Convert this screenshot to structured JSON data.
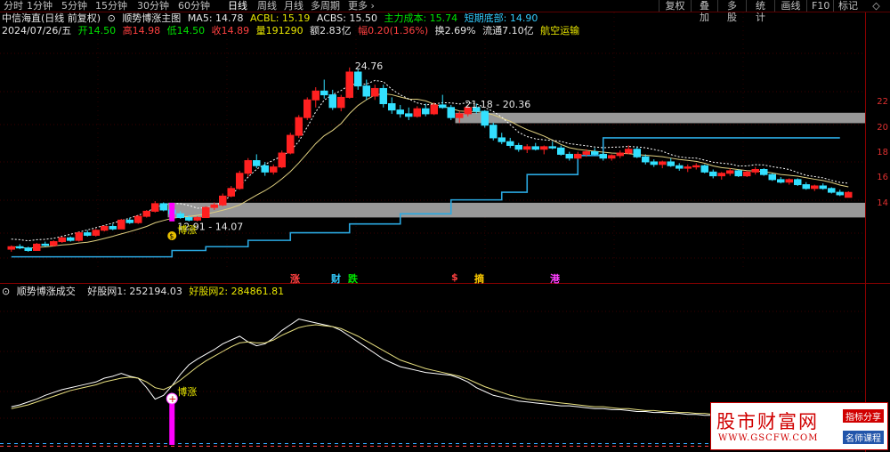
{
  "toolbar": {
    "periods": [
      "分时",
      "1分钟",
      "5分钟",
      "15分钟",
      "30分钟",
      "60分钟",
      "日线",
      "周线",
      "月线",
      "多周期",
      "更多"
    ],
    "active_period": "日线",
    "right_buttons": [
      "复权",
      "叠加",
      "多股",
      "统计",
      "画线",
      "F10",
      "标记"
    ]
  },
  "header": {
    "stock_name": "中信海直(日线 前复权)",
    "indicator_name": "顺势博涨主图",
    "ma5": "MA5: 14.78",
    "acbl": "ACBL: 15.19",
    "acbs": "ACBS: 15.50",
    "main_cost": "主力成本: 15.74",
    "short_bottom": "短期底部: 14.90"
  },
  "quote": {
    "date": "2024/07/26/五",
    "open": "开14.50",
    "high": "高14.98",
    "low": "低14.50",
    "close": "收14.89",
    "volume": "量191290",
    "amount": "额2.83亿",
    "change": "幅0.20(1.36%)",
    "turnover": "换2.69%",
    "float": "流通7.10亿",
    "sector": "航空运输"
  },
  "price_axis": [
    "22",
    "20",
    "18",
    "16",
    "14"
  ],
  "annotations": {
    "peak": "24.76",
    "zone_upper": "21.18 - 20.36",
    "zone_lower": "12.91 - 14.07",
    "buy_label": "博涨",
    "coin_icon_text": "$"
  },
  "events": [
    {
      "label": "涨",
      "color": "#ff4040"
    },
    {
      "label": "财",
      "color": "#33ccff"
    },
    {
      "label": "跌",
      "color": "#00e600"
    },
    {
      "label": "$",
      "color": "#ff4040"
    },
    {
      "label": "摘",
      "color": "#ffcc00"
    },
    {
      "label": "港",
      "color": "#ff40ff"
    }
  ],
  "sub": {
    "title": "顺势博涨成交",
    "v1": "好股网1: 252194.03",
    "v2": "好股网2: 284861.81",
    "buy_label": "博涨"
  },
  "watermark": {
    "main": "股市财富网",
    "url": "WWW.GSCFW.COM",
    "tag1": "指标分享",
    "tag2": "名师课程"
  },
  "colors": {
    "up": "#ff2020",
    "down": "#33e0ff",
    "ma": "#e0d080",
    "support": "#2aa8e0",
    "zone": "#a8a8a8",
    "signal": "#ff00ff"
  },
  "chart_data": {
    "type": "candlestick",
    "candles": [
      [
        10.4,
        10.7,
        10.2,
        10.6
      ],
      [
        10.6,
        10.8,
        10.4,
        10.5
      ],
      [
        10.5,
        10.6,
        10.2,
        10.3
      ],
      [
        10.3,
        10.9,
        10.3,
        10.8
      ],
      [
        10.8,
        11.0,
        10.6,
        10.7
      ],
      [
        10.7,
        11.1,
        10.6,
        11.0
      ],
      [
        11.0,
        11.4,
        10.9,
        11.3
      ],
      [
        11.3,
        11.4,
        11.0,
        11.1
      ],
      [
        11.1,
        11.8,
        11.0,
        11.7
      ],
      [
        11.7,
        11.9,
        11.4,
        11.5
      ],
      [
        11.5,
        12.0,
        11.4,
        11.9
      ],
      [
        11.9,
        12.3,
        11.8,
        12.2
      ],
      [
        12.2,
        12.4,
        11.9,
        12.0
      ],
      [
        12.0,
        12.8,
        12.0,
        12.7
      ],
      [
        12.7,
        12.9,
        12.4,
        12.5
      ],
      [
        12.5,
        13.1,
        12.4,
        13.0
      ],
      [
        13.0,
        13.5,
        12.9,
        13.4
      ],
      [
        13.4,
        14.2,
        13.3,
        14.0
      ],
      [
        14.0,
        14.1,
        13.4,
        13.5
      ],
      [
        13.5,
        13.8,
        13.1,
        13.2
      ],
      [
        13.2,
        13.4,
        12.8,
        12.9
      ],
      [
        12.9,
        13.1,
        12.6,
        12.7
      ],
      [
        12.7,
        13.0,
        12.6,
        12.9
      ],
      [
        12.9,
        13.8,
        12.9,
        13.7
      ],
      [
        13.7,
        14.1,
        13.5,
        13.9
      ],
      [
        13.9,
        14.8,
        13.8,
        14.6
      ],
      [
        14.6,
        15.4,
        14.5,
        15.2
      ],
      [
        15.2,
        16.6,
        15.1,
        16.4
      ],
      [
        16.4,
        17.6,
        16.1,
        17.4
      ],
      [
        17.4,
        17.9,
        16.8,
        17.0
      ],
      [
        17.0,
        17.3,
        16.2,
        16.5
      ],
      [
        16.5,
        17.1,
        16.3,
        16.9
      ],
      [
        16.9,
        18.2,
        16.8,
        18.0
      ],
      [
        18.0,
        19.6,
        17.9,
        19.4
      ],
      [
        19.4,
        21.0,
        19.2,
        20.8
      ],
      [
        20.8,
        22.4,
        20.6,
        22.2
      ],
      [
        22.2,
        23.2,
        21.6,
        22.9
      ],
      [
        22.9,
        23.8,
        22.3,
        22.6
      ],
      [
        22.6,
        23.0,
        21.4,
        21.6
      ],
      [
        21.6,
        22.6,
        21.3,
        22.4
      ],
      [
        22.4,
        24.76,
        22.3,
        24.4
      ],
      [
        24.4,
        24.6,
        23.0,
        23.3
      ],
      [
        23.3,
        23.8,
        22.2,
        22.5
      ],
      [
        22.5,
        23.4,
        22.2,
        23.1
      ],
      [
        23.1,
        23.4,
        21.6,
        21.9
      ],
      [
        21.9,
        22.4,
        21.1,
        21.4
      ],
      [
        21.4,
        21.8,
        20.8,
        21.1
      ],
      [
        21.1,
        21.6,
        20.6,
        20.9
      ],
      [
        20.9,
        21.7,
        20.8,
        21.5
      ],
      [
        21.5,
        21.9,
        20.9,
        21.1
      ],
      [
        21.1,
        22.0,
        21.0,
        21.8
      ],
      [
        21.8,
        22.6,
        21.5,
        21.6
      ],
      [
        21.6,
        21.8,
        20.6,
        20.8
      ],
      [
        20.8,
        21.3,
        20.4,
        21.1
      ],
      [
        21.1,
        21.8,
        20.9,
        21.6
      ],
      [
        21.6,
        21.9,
        21.1,
        21.3
      ],
      [
        21.3,
        21.4,
        20.0,
        20.2
      ],
      [
        20.2,
        20.4,
        19.0,
        19.2
      ],
      [
        19.2,
        19.6,
        18.7,
        18.9
      ],
      [
        18.9,
        19.2,
        18.4,
        18.6
      ],
      [
        18.6,
        18.8,
        18.1,
        18.3
      ],
      [
        18.3,
        18.7,
        18.0,
        18.5
      ],
      [
        18.5,
        18.8,
        18.2,
        18.3
      ],
      [
        18.3,
        18.6,
        17.9,
        18.5
      ],
      [
        18.5,
        18.9,
        18.3,
        18.4
      ],
      [
        18.4,
        18.6,
        17.8,
        17.9
      ],
      [
        17.9,
        18.1,
        17.4,
        17.6
      ],
      [
        17.6,
        18.1,
        17.5,
        17.9
      ],
      [
        17.9,
        18.3,
        17.7,
        18.1
      ],
      [
        18.1,
        18.4,
        17.8,
        17.9
      ],
      [
        17.9,
        18.1,
        17.4,
        17.6
      ],
      [
        17.6,
        17.9,
        17.4,
        17.8
      ],
      [
        17.8,
        18.2,
        17.6,
        18.0
      ],
      [
        18.0,
        18.6,
        17.9,
        18.3
      ],
      [
        18.3,
        18.5,
        17.6,
        17.7
      ],
      [
        17.7,
        17.9,
        17.1,
        17.3
      ],
      [
        17.3,
        17.5,
        16.9,
        17.1
      ],
      [
        17.1,
        17.4,
        16.8,
        17.3
      ],
      [
        17.3,
        17.6,
        16.9,
        17.0
      ],
      [
        17.0,
        17.2,
        16.6,
        16.8
      ],
      [
        16.8,
        17.1,
        16.5,
        16.9
      ],
      [
        16.9,
        17.2,
        16.7,
        17.0
      ],
      [
        17.0,
        17.1,
        16.4,
        16.5
      ],
      [
        16.5,
        16.7,
        16.0,
        16.2
      ],
      [
        16.2,
        16.5,
        15.9,
        16.4
      ],
      [
        16.4,
        16.8,
        16.2,
        16.6
      ],
      [
        16.6,
        16.7,
        16.1,
        16.2
      ],
      [
        16.2,
        16.6,
        16.1,
        16.5
      ],
      [
        16.5,
        16.9,
        16.3,
        16.7
      ],
      [
        16.7,
        16.8,
        16.2,
        16.3
      ],
      [
        16.3,
        16.4,
        15.8,
        15.9
      ],
      [
        15.9,
        16.1,
        15.6,
        15.7
      ],
      [
        15.7,
        16.0,
        15.5,
        15.9
      ],
      [
        15.9,
        16.0,
        15.4,
        15.5
      ],
      [
        15.5,
        15.7,
        15.1,
        15.2
      ],
      [
        15.2,
        15.5,
        15.0,
        15.4
      ],
      [
        15.4,
        15.6,
        15.1,
        15.2
      ],
      [
        15.2,
        15.3,
        14.8,
        14.9
      ],
      [
        14.9,
        15.1,
        14.6,
        14.7
      ],
      [
        14.5,
        14.98,
        14.5,
        14.89
      ]
    ],
    "y_range": [
      9.0,
      27.0
    ],
    "price_ticks": [
      22,
      20,
      18,
      16,
      14
    ],
    "zones": [
      {
        "label": "21.18 - 20.36",
        "low": 20.36,
        "high": 21.18,
        "from_index": 53
      },
      {
        "label": "12.91 - 14.07",
        "low": 12.91,
        "high": 14.07,
        "from_index": 19
      }
    ],
    "support_steps": [
      [
        0,
        9.8
      ],
      [
        19,
        10.3
      ],
      [
        23,
        10.6
      ],
      [
        28,
        11.1
      ],
      [
        33,
        11.7
      ],
      [
        40,
        12.4
      ],
      [
        46,
        13.2
      ],
      [
        52,
        14.3
      ],
      [
        58,
        14.9
      ],
      [
        61,
        16.3
      ],
      [
        67,
        17.8
      ],
      [
        70,
        19.2
      ],
      [
        98,
        19.2
      ]
    ],
    "sub_series1": [
      40,
      42,
      45,
      48,
      52,
      55,
      58,
      60,
      62,
      64,
      66,
      70,
      72,
      75,
      72,
      70,
      60,
      48,
      52,
      62,
      74,
      84,
      90,
      95,
      100,
      106,
      110,
      114,
      108,
      104,
      106,
      112,
      120,
      126,
      132,
      130,
      128,
      126,
      124,
      120,
      114,
      108,
      102,
      96,
      90,
      86,
      82,
      80,
      78,
      76,
      75,
      74,
      73,
      70,
      66,
      60,
      56,
      52,
      50,
      48,
      46,
      45,
      44,
      43,
      42,
      41,
      41,
      40,
      39,
      38,
      38,
      37,
      37,
      36,
      35,
      35,
      34,
      34,
      33,
      33,
      32,
      32,
      31,
      31,
      30,
      30,
      29,
      29,
      28,
      28,
      27,
      27,
      27,
      26,
      26,
      26,
      25,
      25,
      25,
      25
    ],
    "sub_series2": [
      38,
      40,
      42,
      45,
      48,
      51,
      54,
      57,
      59,
      61,
      63,
      66,
      68,
      70,
      71,
      70,
      66,
      60,
      58,
      62,
      68,
      75,
      82,
      88,
      93,
      98,
      103,
      107,
      108,
      107,
      107,
      110,
      115,
      119,
      123,
      125,
      126,
      125,
      124,
      122,
      118,
      114,
      109,
      104,
      99,
      94,
      89,
      86,
      83,
      80,
      78,
      76,
      74,
      72,
      69,
      65,
      61,
      58,
      55,
      52,
      50,
      48,
      47,
      46,
      45,
      44,
      43,
      42,
      41,
      40,
      40,
      39,
      38,
      38,
      37,
      36,
      36,
      35,
      35,
      34,
      34,
      33,
      33,
      32,
      32,
      31,
      31,
      30,
      30,
      29,
      29,
      28,
      28,
      28,
      27,
      27,
      26,
      26,
      26,
      26
    ],
    "signal_index": 19
  }
}
